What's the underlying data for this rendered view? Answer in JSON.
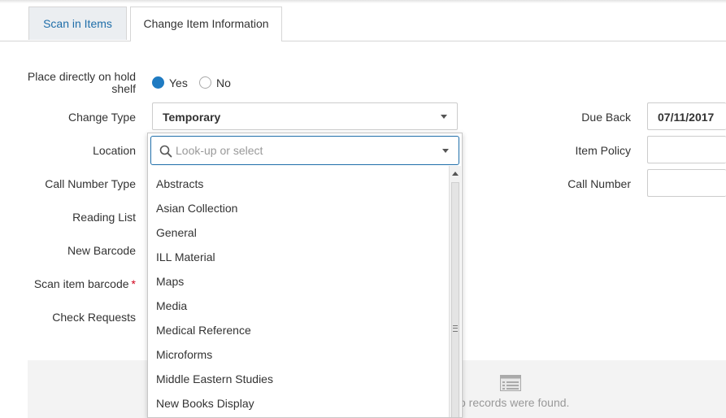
{
  "tabs": [
    {
      "label": "Scan in Items",
      "active": false
    },
    {
      "label": "Change Item Information",
      "active": true
    }
  ],
  "form": {
    "hold_shelf_label": "Place directly on hold shelf",
    "hold_shelf_yes": "Yes",
    "hold_shelf_no": "No",
    "hold_shelf_selected": "Yes",
    "change_type_label": "Change Type",
    "change_type_value": "Temporary",
    "location_label": "Location",
    "call_number_type_label": "Call Number Type",
    "reading_list_label": "Reading List",
    "new_barcode_label": "New Barcode",
    "scan_item_barcode_label": "Scan item barcode",
    "required_marker": "*",
    "check_requests_label": "Check Requests",
    "due_back_label": "Due Back",
    "due_back_value": "07/11/2017",
    "item_policy_label": "Item Policy",
    "call_number_label": "Call Number"
  },
  "dropdown": {
    "placeholder": "Look-up or select",
    "options": [
      "Abstracts",
      "Asian Collection",
      "General",
      "ILL Material",
      "Maps",
      "Media",
      "Medical Reference",
      "Microforms",
      "Middle Eastern Studies",
      "New Books Display"
    ]
  },
  "results": {
    "empty_text": "o records were found."
  },
  "colors": {
    "accent": "#1f7bc2",
    "link": "#1f6ea9",
    "required": "#d0021b"
  }
}
